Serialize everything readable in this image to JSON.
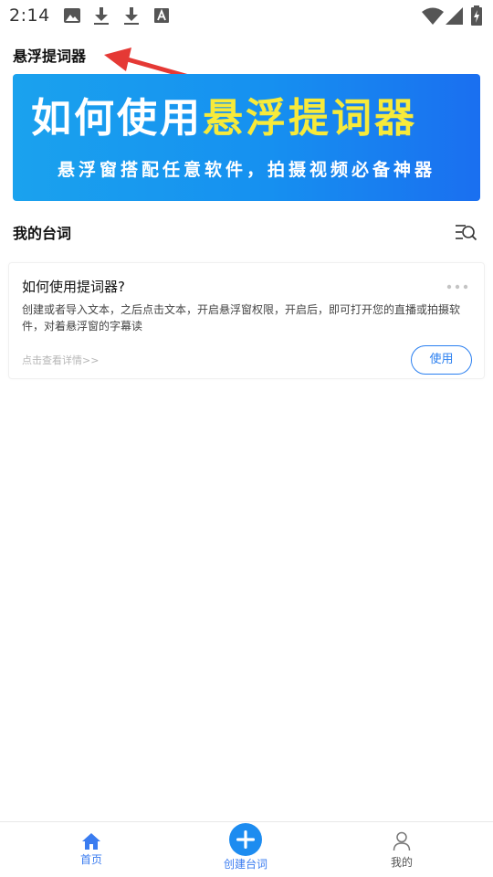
{
  "status_bar": {
    "time": "2:14",
    "icons": [
      "image-icon",
      "download-icon",
      "download-icon",
      "a-icon",
      "wifi-icon",
      "cellular-icon",
      "battery-charging-icon"
    ]
  },
  "header": {
    "title": "悬浮提词器"
  },
  "banner": {
    "line1_white": "如何使用",
    "line1_yellow": "悬浮提词器",
    "line2": "悬浮窗搭配任意软件，拍摄视频必备神器"
  },
  "section": {
    "title": "我的台词",
    "action_icon": "sort-search-icon"
  },
  "card": {
    "title": "如何使用提词器?",
    "more_icon": "more-dots-icon",
    "description": "创建或者导入文本，之后点击文本，开启悬浮窗权限，开启后，即可打开您的直播或拍摄软件，对着悬浮窗的字幕读",
    "detail_link": "点击查看详情>>",
    "use_label": "使用"
  },
  "bottom_nav": {
    "home_label": "首页",
    "create_label": "创建台词",
    "me_label": "我的"
  },
  "colors": {
    "accent": "#3a7cf0",
    "banner_start": "#1aa2ee",
    "banner_end": "#1a6ff0",
    "banner_highlight": "#f7ea3a",
    "annotation_arrow": "#e53935"
  }
}
